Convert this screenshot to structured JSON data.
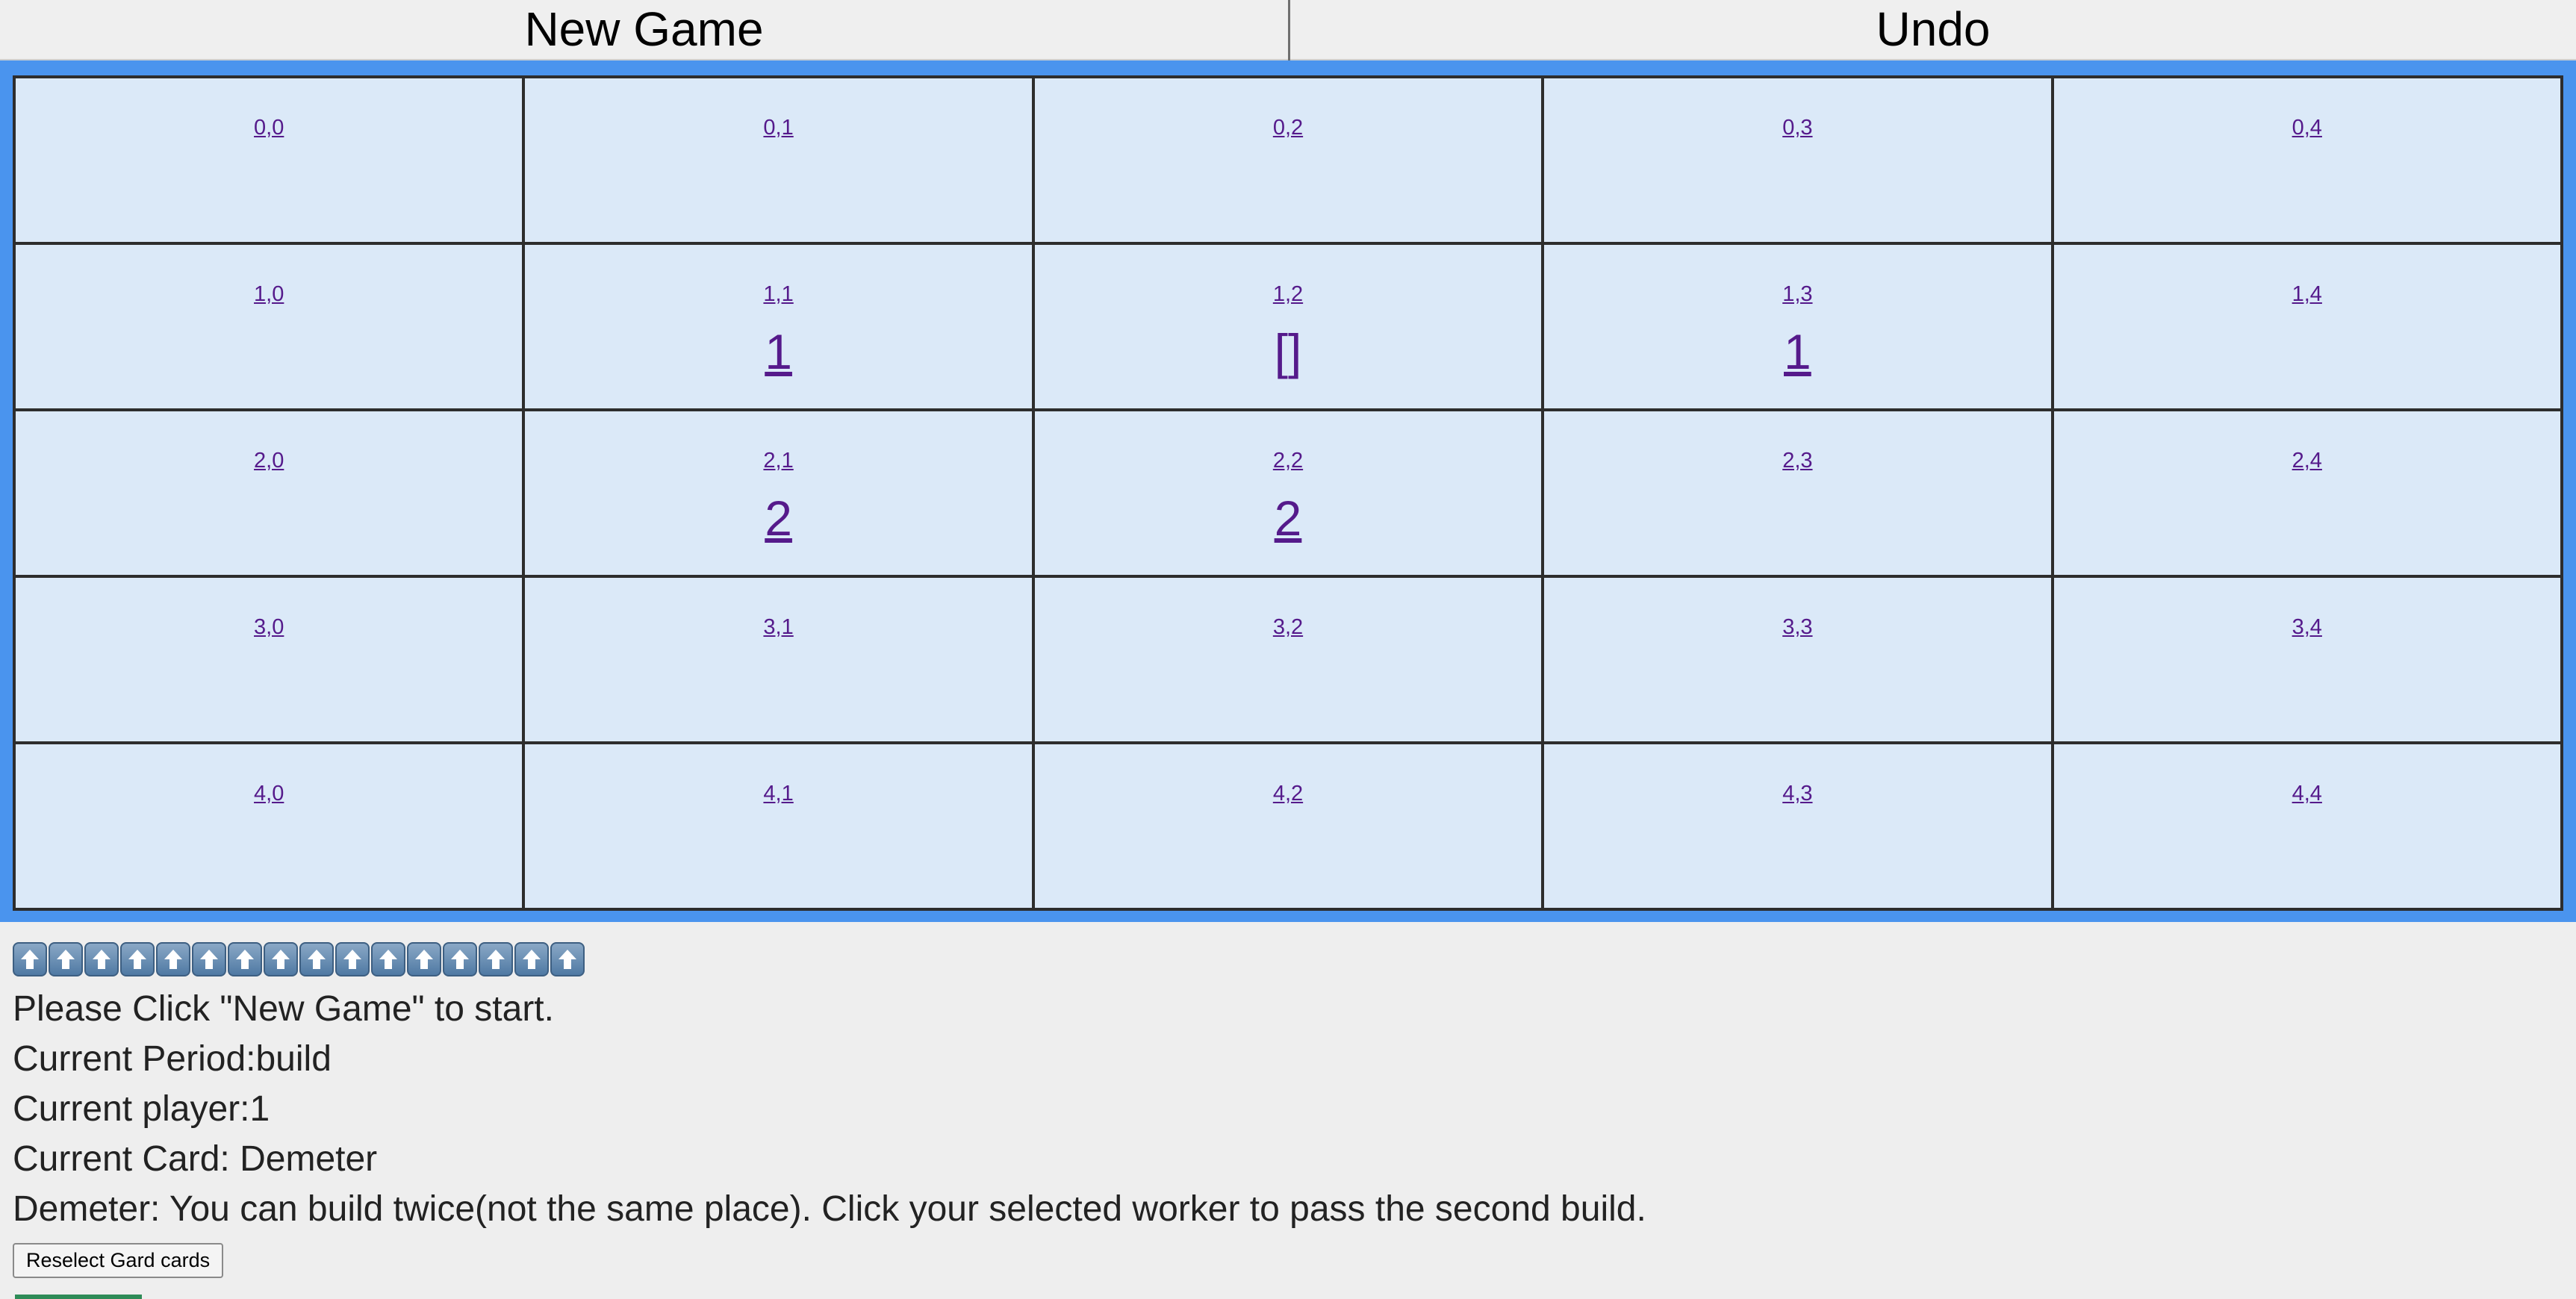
{
  "toolbar": {
    "new_game_label": "New Game",
    "undo_label": "Undo"
  },
  "board": {
    "rows": [
      [
        {
          "coord": "0,0",
          "level": ""
        },
        {
          "coord": "0,1",
          "level": ""
        },
        {
          "coord": "0,2",
          "level": ""
        },
        {
          "coord": "0,3",
          "level": ""
        },
        {
          "coord": "0,4",
          "level": ""
        }
      ],
      [
        {
          "coord": "1,0",
          "level": ""
        },
        {
          "coord": "1,1",
          "level": "1"
        },
        {
          "coord": "1,2",
          "level": "[]"
        },
        {
          "coord": "1,3",
          "level": "1"
        },
        {
          "coord": "1,4",
          "level": ""
        }
      ],
      [
        {
          "coord": "2,0",
          "level": ""
        },
        {
          "coord": "2,1",
          "level": "2"
        },
        {
          "coord": "2,2",
          "level": "2"
        },
        {
          "coord": "2,3",
          "level": ""
        },
        {
          "coord": "2,4",
          "level": ""
        }
      ],
      [
        {
          "coord": "3,0",
          "level": ""
        },
        {
          "coord": "3,1",
          "level": ""
        },
        {
          "coord": "3,2",
          "level": ""
        },
        {
          "coord": "3,3",
          "level": ""
        },
        {
          "coord": "3,4",
          "level": ""
        }
      ],
      [
        {
          "coord": "4,0",
          "level": ""
        },
        {
          "coord": "4,1",
          "level": ""
        },
        {
          "coord": "4,2",
          "level": ""
        },
        {
          "coord": "4,3",
          "level": ""
        },
        {
          "coord": "4,4",
          "level": ""
        }
      ]
    ]
  },
  "status": {
    "arrow_icon": "up-arrow-icon",
    "arrow_count": 16,
    "prompt": "Please Click \"New Game\" to start.",
    "period": "Current Period:build",
    "player": "Current player:1",
    "card": "Current Card: Demeter",
    "card_desc": "Demeter: You can build twice(not the same place). Click your selected worker to pass the second build.",
    "reselect_label": "Reselect Gard cards"
  },
  "colors": {
    "board_border": "#4a94ee",
    "cell_bg": "#dbe9f8",
    "link": "#551a8b"
  }
}
